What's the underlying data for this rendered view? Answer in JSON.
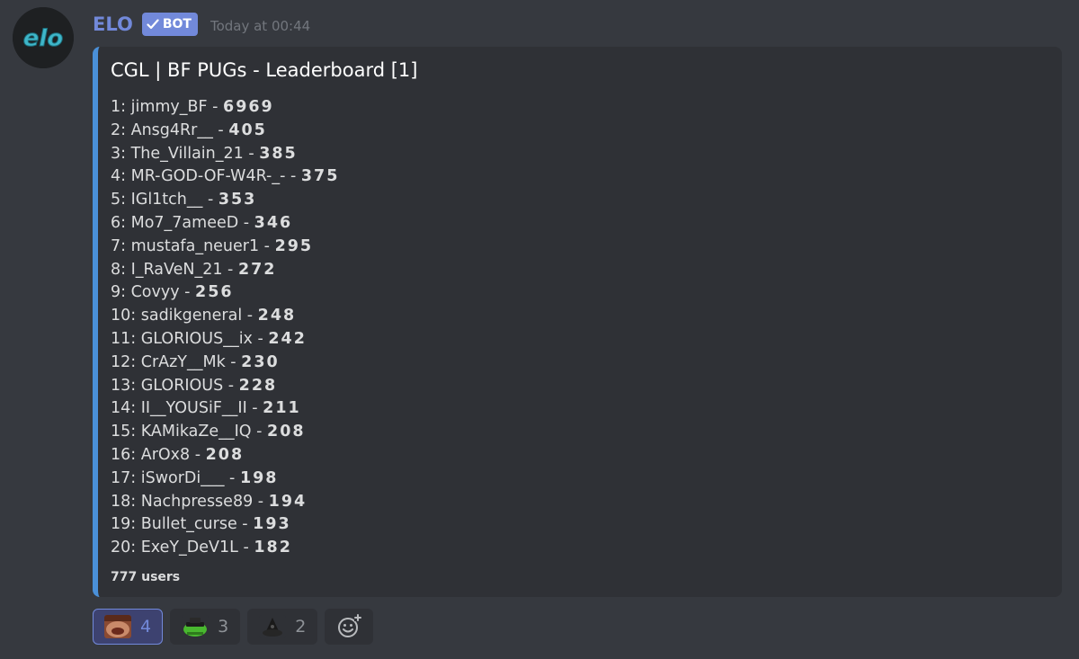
{
  "author": {
    "name": "ELO",
    "avatar_text": "elo",
    "bot_tag": "BOT",
    "timestamp": "Today at 00:44"
  },
  "embed": {
    "title": "CGL | BF PUGs - Leaderboard [1]",
    "accent_color": "#4a90d9",
    "entries": [
      {
        "prefix": "1: jimmy_BF - ",
        "score": "6969"
      },
      {
        "prefix": "2: Ansg4Rr__ - ",
        "score": "405"
      },
      {
        "prefix": "3: The_Villain_21 - ",
        "score": "385"
      },
      {
        "prefix": "4: MR-GOD-OF-W4R-_- - ",
        "score": "375"
      },
      {
        "prefix": "5: IGl1tch__ - ",
        "score": "353"
      },
      {
        "prefix": "6: Mo7_7ameeD - ",
        "score": "346"
      },
      {
        "prefix": "7: mustafa_neuer1 - ",
        "score": "295"
      },
      {
        "prefix": "8: I_RaVeN_21 - ",
        "score": "272"
      },
      {
        "prefix": "9: Covyy - ",
        "score": "256"
      },
      {
        "prefix": "10: sadikgeneral - ",
        "score": "248"
      },
      {
        "prefix": "11: GLORIOUS__ix - ",
        "score": "242"
      },
      {
        "prefix": "12: CrAzY__Mk - ",
        "score": "230"
      },
      {
        "prefix": "13: GLORIOUS - ",
        "score": "228"
      },
      {
        "prefix": "14: II__YOUSiF__II - ",
        "score": "211"
      },
      {
        "prefix": "15: KAMikaZe__IQ - ",
        "score": "208"
      },
      {
        "prefix": "16: ArOx8 - ",
        "score": "208"
      },
      {
        "prefix": "17: iSworDi___ - ",
        "score": "198"
      },
      {
        "prefix": "18: Nachpresse89 - ",
        "score": "194"
      },
      {
        "prefix": "19: Bullet_curse - ",
        "score": "193"
      },
      {
        "prefix": "20: ExeY_DeV1L - ",
        "score": "182"
      }
    ],
    "footer": "777 users"
  },
  "reactions": [
    {
      "emoji": "face-emoji",
      "count": "4",
      "active": true
    },
    {
      "emoji": "frog-emoji",
      "count": "3",
      "active": false
    },
    {
      "emoji": "hat-emoji",
      "count": "2",
      "active": false
    }
  ],
  "add_reaction_icon": "add-reaction-icon",
  "colors": {
    "background": "#36393f",
    "embed_bg": "#2f3136",
    "username": "#7289da",
    "bot_tag": "#7289da"
  }
}
